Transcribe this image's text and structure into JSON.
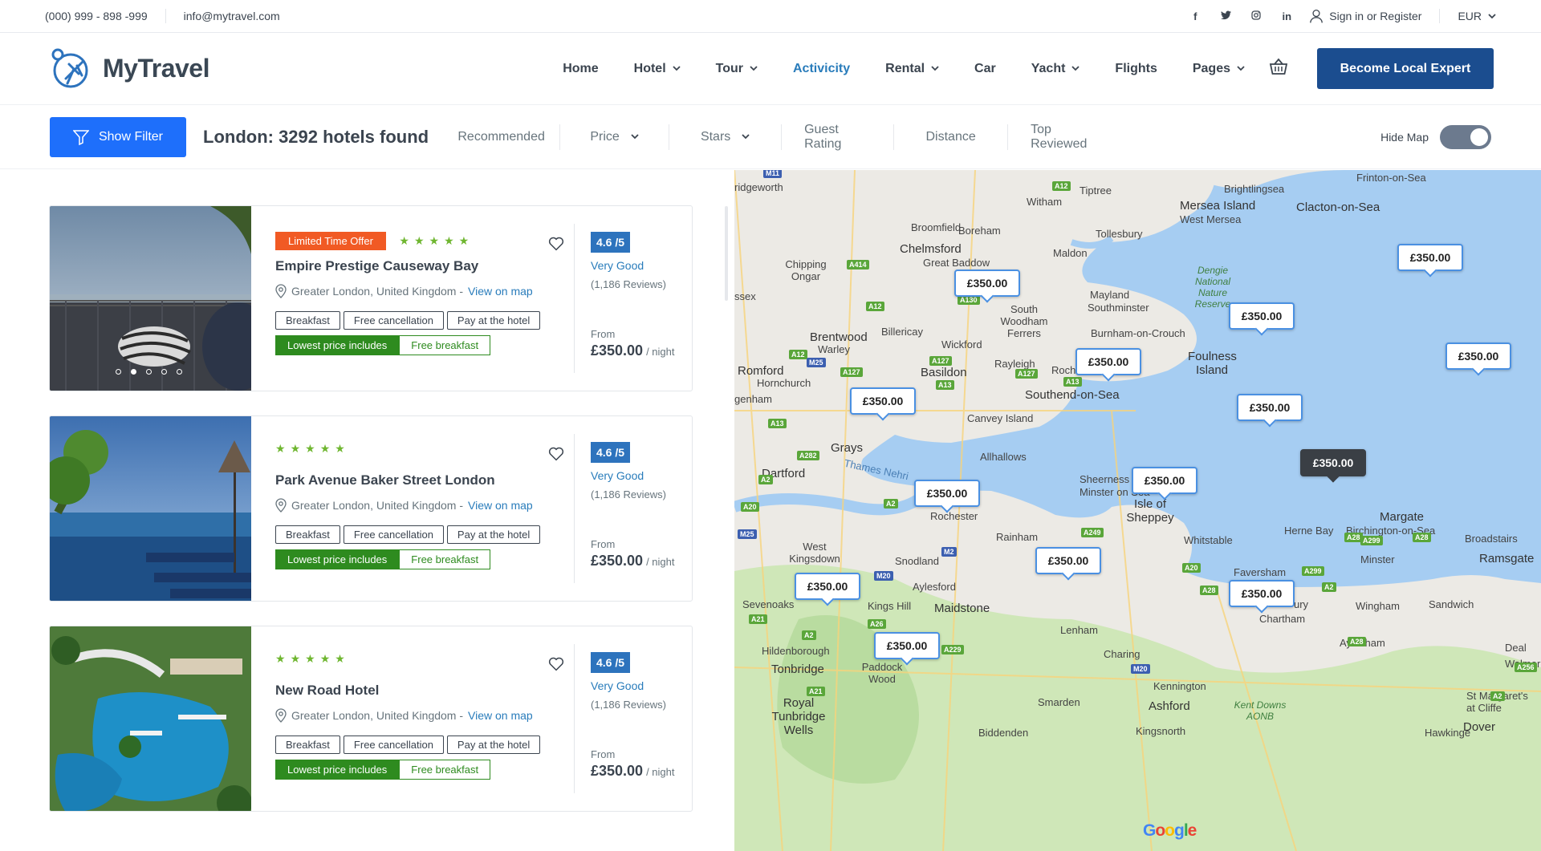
{
  "topbar": {
    "phone": "(000) 999 - 898 -999",
    "email": "info@mytravel.com",
    "social_icons": [
      "facebook-icon",
      "twitter-icon",
      "instagram-icon",
      "linkedin-icon"
    ],
    "social_glyphs": [
      "f",
      "t",
      "◎",
      "in"
    ],
    "signin_label": "Sign in or Register",
    "currency": "EUR"
  },
  "header": {
    "logo_text": "MyTravel",
    "nav": [
      {
        "label": "Home",
        "dropdown": false,
        "active": false
      },
      {
        "label": "Hotel",
        "dropdown": true,
        "active": false
      },
      {
        "label": "Tour",
        "dropdown": true,
        "active": false
      },
      {
        "label": "Activicity",
        "dropdown": false,
        "active": true
      },
      {
        "label": "Rental",
        "dropdown": true,
        "active": false
      },
      {
        "label": "Car",
        "dropdown": false,
        "active": false
      },
      {
        "label": "Yacht",
        "dropdown": true,
        "active": false
      },
      {
        "label": "Flights",
        "dropdown": false,
        "active": false
      },
      {
        "label": "Pages",
        "dropdown": true,
        "active": false
      }
    ],
    "cta_label": "Become Local Expert"
  },
  "filterbar": {
    "show_filter_label": "Show Filter",
    "results_text": "London: 3292 hotels found",
    "sorts": [
      {
        "label": "Recommended",
        "dropdown": false
      },
      {
        "label": "Price",
        "dropdown": true
      },
      {
        "label": "Stars",
        "dropdown": true
      },
      {
        "label": "Guest Rating",
        "dropdown": false
      },
      {
        "label": "Distance",
        "dropdown": false
      },
      {
        "label": "Top Reviewed",
        "dropdown": false
      }
    ],
    "hide_map_label": "Hide Map",
    "map_visible": true
  },
  "hotels": [
    {
      "offer_badge": "Limited Time Offer",
      "stars": 5,
      "name": "Empire Prestige Causeway Bay",
      "location": "Greater London, United Kingdom - ",
      "map_link": "View on map",
      "tags": [
        "Breakfast",
        "Free cancellation",
        "Pay at the hotel"
      ],
      "deal_label": "Lowest price includes",
      "deal_value": "Free breakfast",
      "score": "4.6 /5",
      "rating_text": "Very Good",
      "reviews": "(1,186 Reviews)",
      "from_label": "From",
      "price": "£350.00",
      "per": "/ night",
      "carousel_dots": 5,
      "active_dot": 2
    },
    {
      "offer_badge": "",
      "stars": 5,
      "name": "Park Avenue Baker Street London",
      "location": "Greater London, United Kingdom - ",
      "map_link": "View on map",
      "tags": [
        "Breakfast",
        "Free cancellation",
        "Pay at the hotel"
      ],
      "deal_label": "Lowest price includes",
      "deal_value": "Free breakfast",
      "score": "4.6 /5",
      "rating_text": "Very Good",
      "reviews": "(1,186 Reviews)",
      "from_label": "From",
      "price": "£350.00",
      "per": "/ night"
    },
    {
      "offer_badge": "",
      "stars": 5,
      "name": "New Road Hotel",
      "location": "Greater London, United Kingdom - ",
      "map_link": "View on map",
      "tags": [
        "Breakfast",
        "Free cancellation",
        "Pay at the hotel"
      ],
      "deal_label": "Lowest price includes",
      "deal_value": "Free breakfast",
      "score": "4.6 /5",
      "rating_text": "Very Good",
      "reviews": "(1,186 Reviews)",
      "from_label": "From",
      "price": "£350.00",
      "per": "/ night"
    }
  ],
  "map": {
    "price_pins": [
      "£350.00",
      "£350.00",
      "£350.00",
      "£350.00",
      "£350.00",
      "£350.00",
      "£350.00",
      "£350.00",
      "£350.00",
      "£350.00",
      "£350.00",
      "£350.00",
      "£350.00",
      "£350.00"
    ],
    "selected_pin_index": 8,
    "place_labels": [
      "ridgeworth",
      "Witham",
      "Tiptree",
      "Brightlingsea",
      "Frinton-on-Sea",
      "Mersea Island",
      "West Mersea",
      "Clacton-on-Sea",
      "Broomfield",
      "Boreham",
      "Tollesbury",
      "Chelmsford",
      "Great Baddow",
      "Maldon",
      "Chipping Ongar",
      "Dengie National Nature Reserve",
      "Mayland",
      "South Woodham Ferrers",
      "Southminster",
      "Burnham-on-Crouch",
      "Billericay",
      "Brentwood",
      "Warley",
      "Wickford",
      "Foulness Island",
      "Romford",
      "Hornchurch",
      "Basildon",
      "Rayleigh",
      "Rochf",
      "Southend-on-Sea",
      "Canvey Island",
      "Grays",
      "Allhallows",
      "Dartford",
      "Thames Nehri",
      "Sheerness",
      "Minster on Sea",
      "Isle of Sheppey",
      "Rochester",
      "Margate",
      "Birchington-on-Sea",
      "Broadstairs",
      "Whitstable",
      "Herne Bay",
      "Ramsgate",
      "West Kingsdown",
      "Snodland",
      "Rainham",
      "Faversham",
      "Minster",
      "Aylesford",
      "Sevenoaks",
      "Kings Hill",
      "Maidstone",
      "Wingham",
      "Sandwich",
      "Chartham",
      "Hildenborough",
      "Lenham",
      "Aylesham",
      "Deal",
      "Walmer",
      "Tonbridge",
      "Paddock Wood",
      "Charing",
      "Royal Tunbridge Wells",
      "Kennington",
      "Smarden",
      "Ashford",
      "Kent Downs AONB",
      "St Margaret's at Cliffe",
      "Dover",
      "ssex",
      "genham",
      "Kingsnorth",
      "Biddenden",
      "Hawkinge",
      "ury"
    ],
    "road_labels": [
      "M11",
      "A12",
      "A414",
      "A130",
      "A12",
      "A127",
      "A13",
      "A12",
      "M25",
      "A127",
      "A13",
      "A127",
      "A13",
      "A282",
      "A2",
      "A20",
      "A2",
      "M25",
      "M2",
      "M20",
      "A21",
      "A26",
      "A229",
      "A249",
      "A299",
      "A2",
      "A28",
      "A299",
      "A28",
      "A28",
      "A256",
      "M20",
      "A2",
      "A21",
      "A2",
      "A28",
      "A20"
    ],
    "google_letters": [
      "G",
      "o",
      "o",
      "g",
      "l",
      "e"
    ],
    "google_colors": [
      "#4285f4",
      "#ea4335",
      "#fbbc05",
      "#4285f4",
      "#34a853",
      "#ea4335"
    ]
  },
  "colors": {
    "brand_blue": "#1b4d8f",
    "filter_blue": "#1e6ffb",
    "link_blue": "#297cbb",
    "offer_orange": "#f15a24",
    "star_green": "#6fb630",
    "deal_green": "#2e8b1f"
  }
}
